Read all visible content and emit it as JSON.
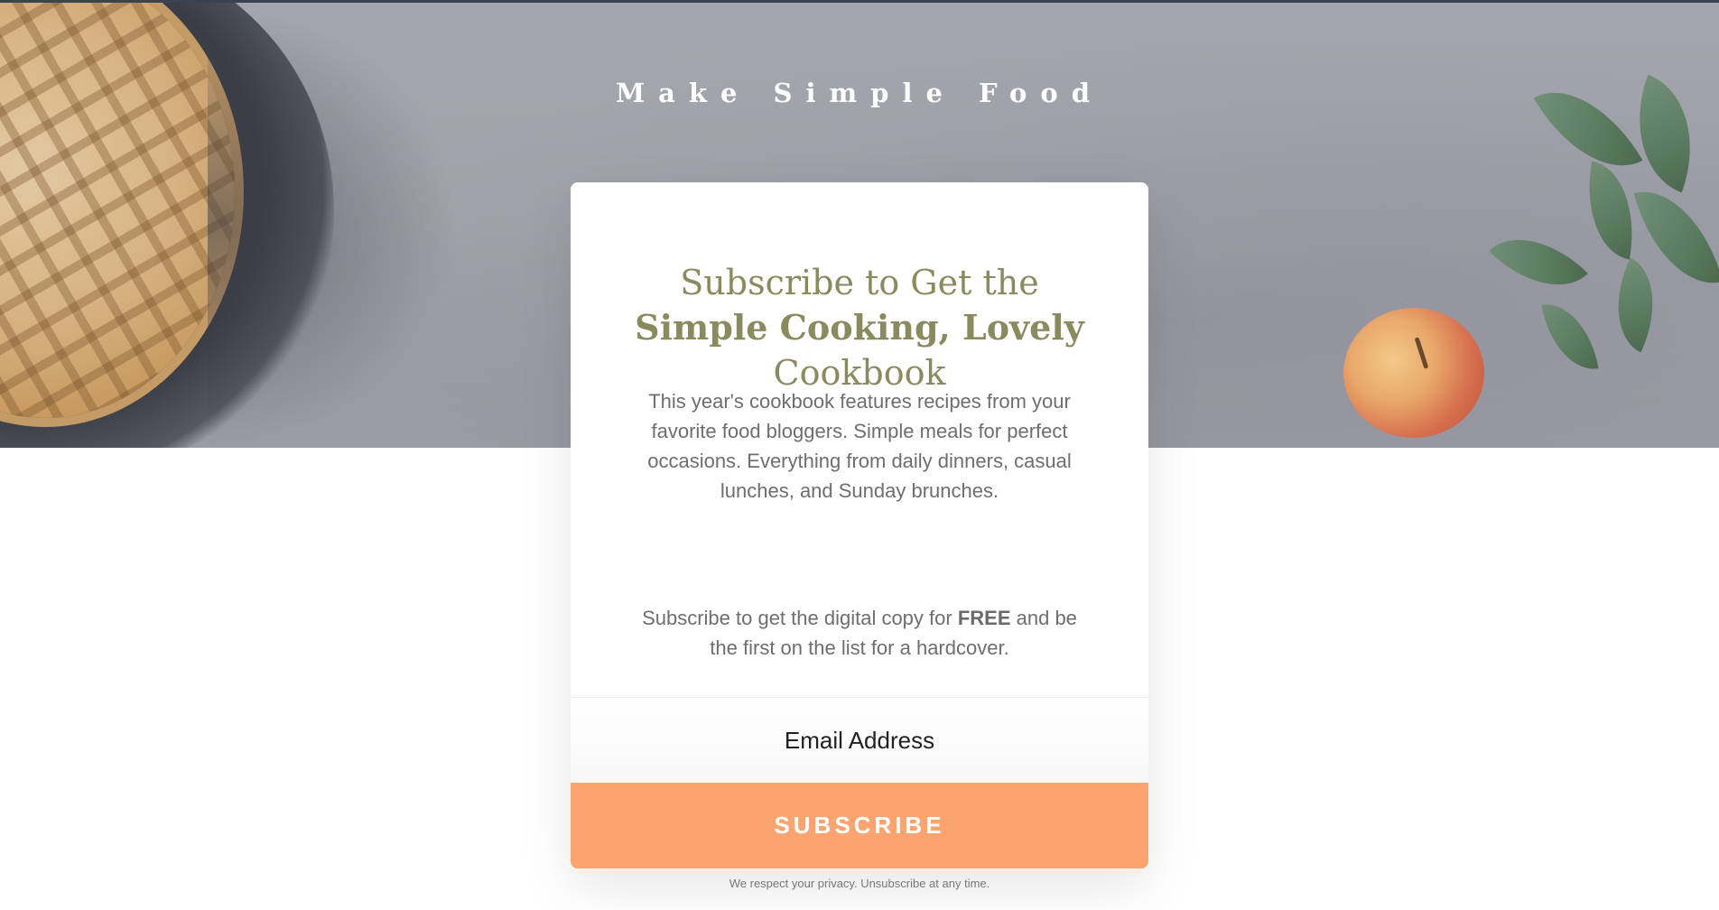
{
  "site": {
    "title": "Make Simple Food"
  },
  "card": {
    "heading_pre": "Subscribe to Get the ",
    "heading_bold": "Simple Cooking, Lovely",
    "heading_post": " Cookbook",
    "description": "This year's cookbook features recipes from your favorite food bloggers. Simple meals for perfect occasions. Everything from daily dinners, casual lunches, and Sunday brunches.",
    "offer_pre": "Subscribe to get the digital copy for ",
    "offer_bold": "FREE",
    "offer_post": " and be the first on the list for a hardcover."
  },
  "form": {
    "email_placeholder": "Email Address",
    "email_value": "",
    "subscribe_label": "SUBSCRIBE"
  },
  "footer": {
    "privacy_text": "We respect your privacy. Unsubscribe at any time."
  },
  "colors": {
    "accent_button": "#fca470",
    "heading_olive": "#8a8a5f",
    "body_text": "#6e6e6e",
    "top_line": "#3b4250"
  }
}
